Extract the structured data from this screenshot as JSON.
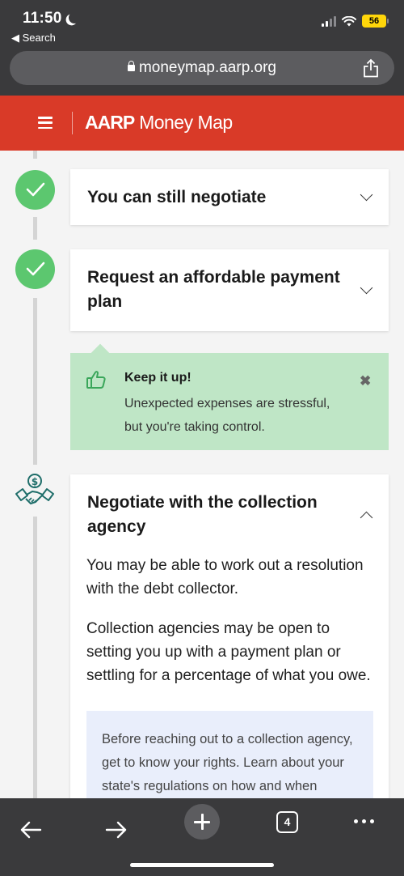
{
  "status_bar": {
    "time": "11:50",
    "back_label": "◀ Search",
    "battery": "56"
  },
  "browser": {
    "url": "moneymap.aarp.org"
  },
  "site_header": {
    "logo_brand": "AARP",
    "logo_product": "Money Map"
  },
  "steps": [
    {
      "title": "You can still negotiate",
      "completed": true
    },
    {
      "title": "Request an affordable payment plan",
      "completed": true
    },
    {
      "title": "Negotiate with the collection agency",
      "completed": false,
      "expanded": true
    }
  ],
  "tip": {
    "title": "Keep it up!",
    "body": "Unexpected expenses are stressful, but you're taking control.",
    "close": "✖"
  },
  "expanded_step": {
    "para1": "You may be able to work out a resolution with the debt collector.",
    "para2": "Collection agencies may be open to setting you up with a payment plan or settling for a percentage of what you owe.",
    "callout": "Before reaching out to a collection agency, get to know your rights. Learn about your state's regulations on how and when"
  },
  "toolbar": {
    "tab_count": "4"
  },
  "colors": {
    "header_red": "#d93a28",
    "check_green": "#5cc76f",
    "tip_green": "#bfe6c6",
    "callout_blue": "#e9eefb",
    "chrome_gray": "#3a3a3c"
  }
}
